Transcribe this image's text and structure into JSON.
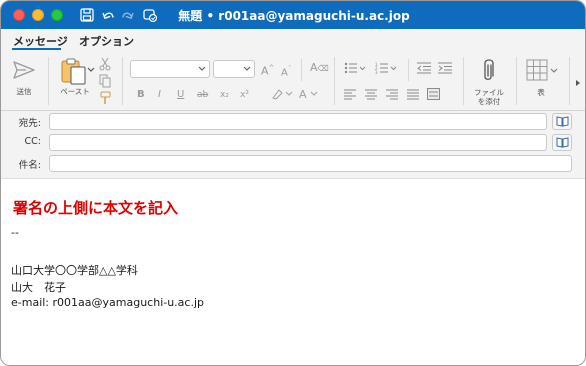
{
  "window": {
    "title": "無題 • r001aa@yamaguchi-u.ac.jop"
  },
  "titlebar_icons": [
    "save-icon",
    "undo-icon",
    "redo-icon",
    "sync-icon"
  ],
  "tabs": [
    {
      "label": "メッセージ",
      "selected": true
    },
    {
      "label": "オプション",
      "selected": false
    }
  ],
  "ribbon": {
    "send_label": "送信",
    "paste_label": "ペースト",
    "attach_label_line1": "ファイル",
    "attach_label_line2": "を添付",
    "table_label": "表",
    "font_name_value": "",
    "font_size_value": "",
    "format_buttons": [
      "B",
      "I",
      "U",
      "ab",
      "x₂",
      "x²"
    ]
  },
  "header": {
    "to_label": "宛先:",
    "cc_label": "CC:",
    "subject_label": "件名:",
    "to_value": "",
    "cc_value": "",
    "subject_value": ""
  },
  "body": {
    "note": "署名の上側に本文を記入",
    "separator": "--",
    "signature_line1": "山口大学〇〇学部△△学科",
    "signature_line2": "山大　花子",
    "signature_line3": "e-mail: r001aa@yamaguchi-u.ac.jp"
  },
  "colors": {
    "titlebar": "#0f6cbd",
    "note_text": "#e00000",
    "tab_underline": "#0f6cbd"
  }
}
